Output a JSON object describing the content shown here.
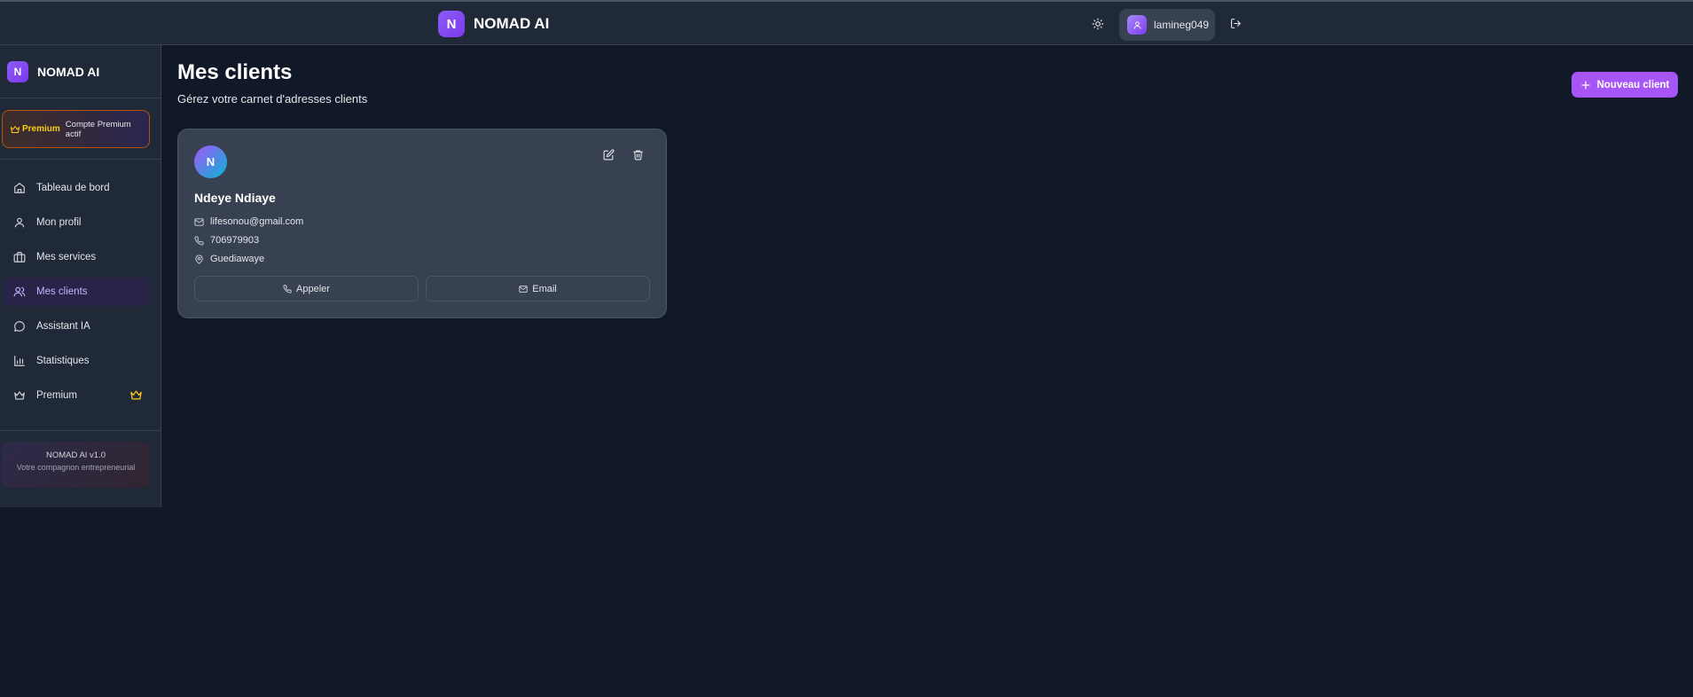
{
  "topbar": {
    "logo_letter": "N",
    "brand": "NOMAD AI",
    "username": "lamineg049"
  },
  "sidebar": {
    "logo_letter": "N",
    "brand": "NOMAD AI",
    "premium": {
      "tag": "Premium",
      "description": "Compte Premium actif"
    },
    "items": [
      {
        "label": "Tableau de bord",
        "icon": "home-icon"
      },
      {
        "label": "Mon profil",
        "icon": "user-icon"
      },
      {
        "label": "Mes services",
        "icon": "briefcase-icon"
      },
      {
        "label": "Mes clients",
        "icon": "users-icon",
        "active": true
      },
      {
        "label": "Assistant IA",
        "icon": "chat-icon"
      },
      {
        "label": "Statistiques",
        "icon": "bar-chart-icon"
      },
      {
        "label": "Premium",
        "icon": "crown-icon"
      }
    ],
    "version_title": "NOMAD AI v1.0",
    "version_subtitle": "Votre compagnon entrepreneurial"
  },
  "main": {
    "title": "Mes clients",
    "subtitle": "Gérez votre carnet d'adresses clients",
    "new_button_label": "Nouveau client"
  },
  "clients": [
    {
      "initial": "N",
      "name": "Ndeye Ndiaye",
      "email": "lifesonou@gmail.com",
      "phone": "706979903",
      "location": "Guediawaye",
      "call_label": "Appeler",
      "email_label": "Email"
    }
  ],
  "colors": {
    "background": "#111827",
    "panel": "#1f2937",
    "card": "#374151",
    "accent": "#a855f7",
    "premium_gold": "#facc15"
  }
}
